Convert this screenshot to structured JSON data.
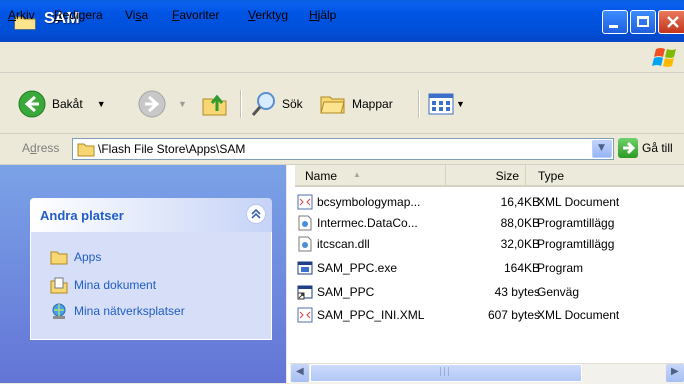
{
  "window": {
    "title": "SAM"
  },
  "menu": {
    "items": [
      {
        "pre": "",
        "u": "A",
        "post": "rkiv"
      },
      {
        "pre": "",
        "u": "R",
        "post": "edigera"
      },
      {
        "pre": "Vi",
        "u": "s",
        "post": "a"
      },
      {
        "pre": "",
        "u": "F",
        "post": "avoriter"
      },
      {
        "pre": "",
        "u": "V",
        "post": "erktyg"
      },
      {
        "pre": "",
        "u": "H",
        "post": "jälp"
      }
    ]
  },
  "toolbar": {
    "back_label": "Bakåt",
    "search_label": "Sök",
    "folders_label": "Mappar"
  },
  "address": {
    "label_pre": "A",
    "label_u": "d",
    "label_post": "ress",
    "path": "\\Flash File Store\\Apps\\SAM",
    "go_label": "Gå till"
  },
  "taskpane": {
    "title": "Andra platser",
    "places": [
      {
        "label": "Apps",
        "icon": "folder-icon"
      },
      {
        "label": "Mina dokument",
        "icon": "documents-icon"
      },
      {
        "label": "Mina nätverksplatser",
        "icon": "network-icon"
      }
    ]
  },
  "filelist": {
    "columns": {
      "name": "Name",
      "size": "Size",
      "type": "Type"
    },
    "rows": [
      {
        "name": "bcsymbologymap...",
        "size": "16,4KB",
        "type": "XML Document",
        "icon": "xml-file-icon"
      },
      {
        "name": "Intermec.DataCo...",
        "size": "88,0KB",
        "type": "Programtillägg",
        "icon": "dll-file-icon"
      },
      {
        "name": "itcscan.dll",
        "size": "32,0KB",
        "type": "Programtillägg",
        "icon": "dll-file-icon"
      },
      {
        "name": "SAM_PPC.exe",
        "size": "164KB",
        "type": "Program",
        "icon": "exe-file-icon"
      },
      {
        "name": "SAM_PPC",
        "size": "43 bytes",
        "type": "Genväg",
        "icon": "shortcut-icon"
      },
      {
        "name": "SAM_PPC_INI.XML",
        "size": "607 bytes",
        "type": "XML Document",
        "icon": "xml-file-icon"
      }
    ]
  },
  "colors": {
    "titlebar": "#0055e5",
    "link": "#215dc6",
    "taskpane_top": "#7ba2e7",
    "taskpane_bottom": "#6375d6"
  }
}
